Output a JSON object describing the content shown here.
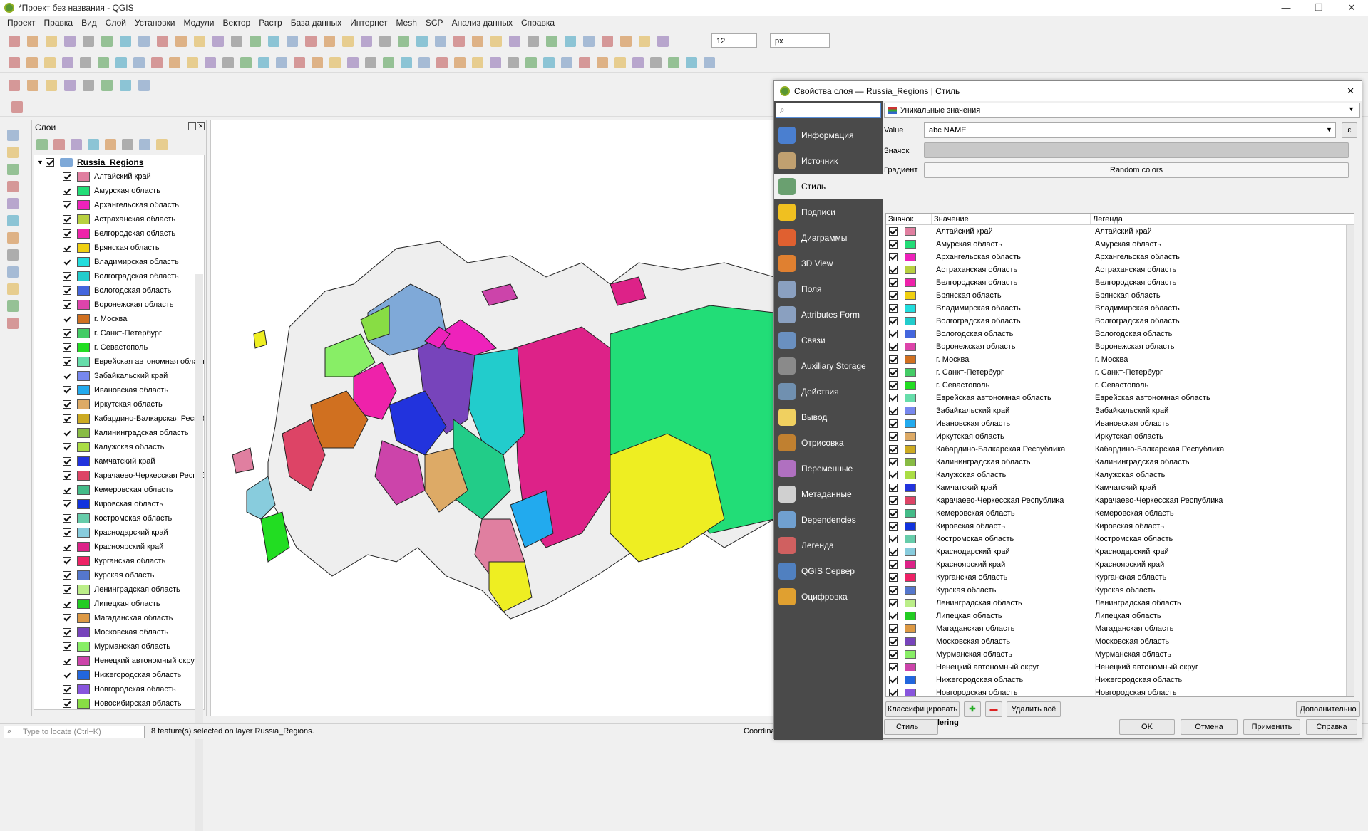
{
  "app": {
    "title": "*Проект без названия - QGIS",
    "win_min": "—",
    "win_max": "❐",
    "win_close": "✕"
  },
  "menu": [
    "Проект",
    "Правка",
    "Вид",
    "Слой",
    "Установки",
    "Модули",
    "Вектор",
    "Растр",
    "База данных",
    "Интернет",
    "Mesh",
    "SCP",
    "Анализ данных",
    "Справка"
  ],
  "toolbar": {
    "font_size_value": "12",
    "unit_value": "px"
  },
  "layers_panel": {
    "title": "Слои",
    "layer_name": "Russia_Regions"
  },
  "regions": [
    {
      "name": "Алтайский край",
      "color": "#e07fa0"
    },
    {
      "name": "Амурская область",
      "color": "#22dd77"
    },
    {
      "name": "Архангельская область",
      "color": "#ee22bb"
    },
    {
      "name": "Астраханская область",
      "color": "#b8d040"
    },
    {
      "name": "Белгородская область",
      "color": "#ee22aa"
    },
    {
      "name": "Брянская область",
      "color": "#f0d010"
    },
    {
      "name": "Владимирская область",
      "color": "#22dddd"
    },
    {
      "name": "Волгоградская область",
      "color": "#22cccc"
    },
    {
      "name": "Вологодская область",
      "color": "#4466dd"
    },
    {
      "name": "Воронежская область",
      "color": "#dd44aa"
    },
    {
      "name": "г. Москва",
      "color": "#d07020"
    },
    {
      "name": "г. Санкт-Петербург",
      "color": "#44cc66"
    },
    {
      "name": "г. Севастополь",
      "color": "#22dd22"
    },
    {
      "name": "Еврейская автономная область",
      "color": "#66ddaa"
    },
    {
      "name": "Забайкальский край",
      "color": "#7788ee"
    },
    {
      "name": "Ивановская область",
      "color": "#22aaee"
    },
    {
      "name": "Иркутская область",
      "color": "#ddaa66"
    },
    {
      "name": "Кабардино-Балкарская Республика",
      "color": "#ccaa22"
    },
    {
      "name": "Калининградская область",
      "color": "#88bb44"
    },
    {
      "name": "Калужская область",
      "color": "#aadd44"
    },
    {
      "name": "Камчатский край",
      "color": "#2233dd"
    },
    {
      "name": "Карачаево-Черкесская Республика",
      "color": "#dd4466"
    },
    {
      "name": "Кемеровская область",
      "color": "#44bb88"
    },
    {
      "name": "Кировская область",
      "color": "#1133dd"
    },
    {
      "name": "Костромская область",
      "color": "#66ccaa"
    },
    {
      "name": "Краснодарский край",
      "color": "#88ccdd"
    },
    {
      "name": "Красноярский край",
      "color": "#dd2288"
    },
    {
      "name": "Курганская область",
      "color": "#ee2266"
    },
    {
      "name": "Курская область",
      "color": "#5577cc"
    },
    {
      "name": "Ленинградская область",
      "color": "#bbee88"
    },
    {
      "name": "Липецкая область",
      "color": "#22cc22"
    },
    {
      "name": "Магаданская область",
      "color": "#dd9944"
    },
    {
      "name": "Московская область",
      "color": "#7744bb"
    },
    {
      "name": "Мурманская область",
      "color": "#88ee66"
    },
    {
      "name": "Ненецкий автономный округ",
      "color": "#cc44aa"
    },
    {
      "name": "Нижегородская область",
      "color": "#2266dd"
    },
    {
      "name": "Новгородская область",
      "color": "#8855dd"
    },
    {
      "name": "Новосибирская область",
      "color": "#88dd44"
    }
  ],
  "status": {
    "locate_placeholder": "Type to locate (Ctrl+K)",
    "message": "8 feature(s) selected on layer Russia_Regions.",
    "coord_label": "Coordina"
  },
  "dialog": {
    "title": "Свойства слоя — Russia_Regions | Стиль",
    "nav": [
      "Информация",
      "Источник",
      "Стиль",
      "Подписи",
      "Диаграммы",
      "3D View",
      "Поля",
      "Attributes Form",
      "Связи",
      "Auxiliary Storage",
      "Действия",
      "Вывод",
      "Отрисовка",
      "Переменные",
      "Метаданные",
      "Dependencies",
      "Легенда",
      "QGIS Сервер",
      "Оцифровка"
    ],
    "renderer": "Уникальные значения",
    "value_label": "Value",
    "value_field": "abc NAME",
    "symbol_label": "Значок",
    "gradient_label": "Градиент",
    "gradient_value": "Random colors",
    "col_symbol": "Значок",
    "col_value": "Значение",
    "col_legend": "Легенда",
    "btn_classify": "Классифицировать",
    "btn_delete_all": "Удалить всё",
    "btn_advanced": "Дополнительно",
    "layer_rendering": "Layer Rendering",
    "btn_style": "Стиль",
    "btn_ok": "OK",
    "btn_cancel": "Отмена",
    "btn_apply": "Применить",
    "btn_help": "Справка"
  }
}
